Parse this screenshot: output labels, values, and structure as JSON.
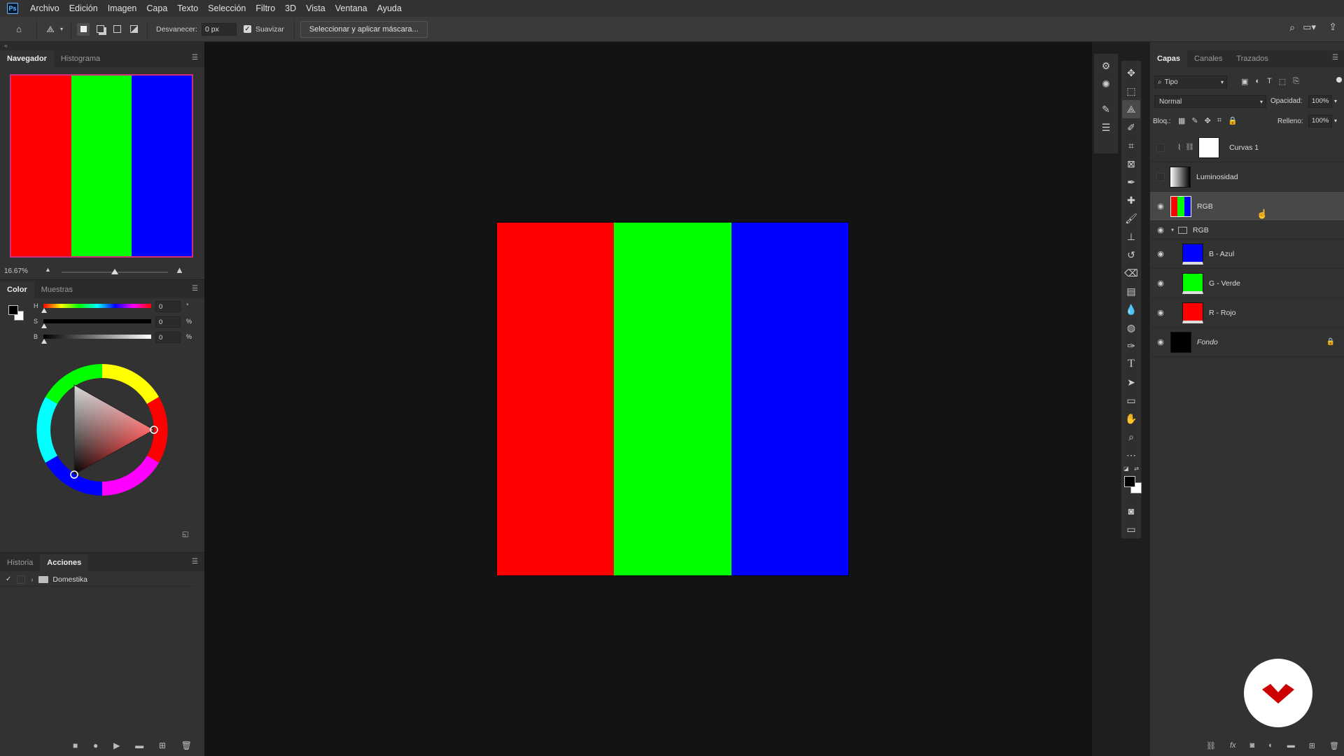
{
  "menubar": {
    "app_icon": "Ps",
    "items": [
      "Archivo",
      "Edición",
      "Imagen",
      "Capa",
      "Texto",
      "Selección",
      "Filtro",
      "3D",
      "Vista",
      "Ventana",
      "Ayuda"
    ]
  },
  "options": {
    "feather_label": "Desvanecer:",
    "feather_value": "0 px",
    "smooth_label": "Suavizar",
    "select_mask_button": "Seleccionar y aplicar máscara..."
  },
  "navigator": {
    "tabs": [
      "Navegador",
      "Histograma"
    ],
    "zoom": "16.67%",
    "zoom_slider_fraction": 0.5
  },
  "color_panel": {
    "tabs": [
      "Color",
      "Muestras"
    ],
    "channels": [
      {
        "label": "H",
        "value": "0",
        "unit": "°"
      },
      {
        "label": "S",
        "value": "0",
        "unit": "%"
      },
      {
        "label": "B",
        "value": "0",
        "unit": "%"
      }
    ],
    "foreground": "#000000",
    "background": "#ffffff"
  },
  "actions_panel": {
    "tabs": [
      "Historia",
      "Acciones"
    ],
    "items": [
      "Domestika"
    ]
  },
  "document": {
    "stripes": [
      "#ff0000",
      "#00ff00",
      "#0000ff"
    ]
  },
  "layers_panel": {
    "tabs": [
      "Capas",
      "Canales",
      "Trazados"
    ],
    "filter_kind": "Tipo",
    "blend_mode": "Normal",
    "opacity_label": "Opacidad:",
    "opacity_value": "100%",
    "lock_label": "Bloq.:",
    "fill_label": "Relleno:",
    "fill_value": "100%",
    "layers": [
      {
        "name": "Curvas 1",
        "visible": false
      },
      {
        "name": "Luminosidad",
        "visible": false
      },
      {
        "name": "RGB",
        "visible": true,
        "selected": true
      },
      {
        "name": "RGB",
        "visible": true,
        "group": true
      },
      {
        "name": "B - Azul",
        "visible": true,
        "color": "#0000ff"
      },
      {
        "name": "G - Verde",
        "visible": true,
        "color": "#00ff00"
      },
      {
        "name": "R - Rojo",
        "visible": true,
        "color": "#ff0000"
      },
      {
        "name": "Fondo",
        "visible": true,
        "color": "#000000",
        "locked": true
      }
    ]
  },
  "brand": {
    "accent": "#cc0000"
  }
}
